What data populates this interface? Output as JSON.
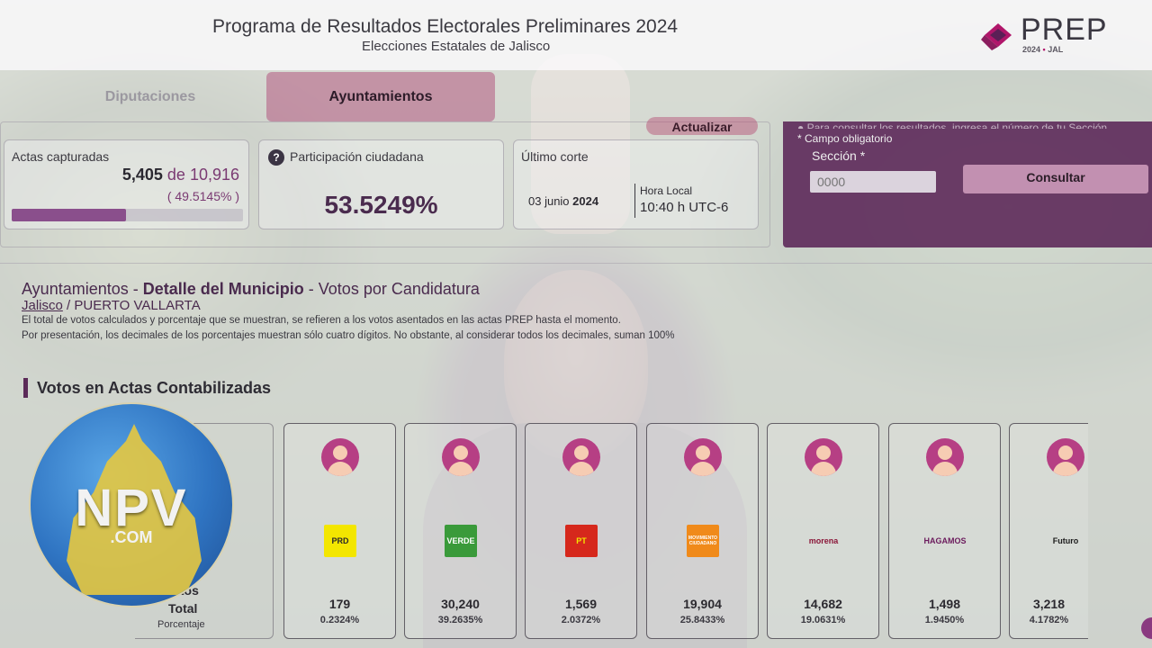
{
  "header": {
    "title": "Programa de Resultados Electorales Preliminares 2024",
    "subtitle": "Elecciones Estatales de Jalisco",
    "logo_text": "PREP",
    "logo_year": "2024",
    "logo_dot": "•",
    "logo_state": "JAL"
  },
  "tabs": [
    {
      "label": "Diputaciones"
    },
    {
      "label": "Ayuntamientos"
    }
  ],
  "refresh_label": "Actualizar",
  "stats": {
    "actas_label": "Actas capturadas",
    "actas_captured": "5,405",
    "actas_de": "de",
    "actas_total": "10,916",
    "actas_pct": "( 49.5145% )",
    "actas_progress": 0.495145,
    "participacion_icon": "?",
    "participacion_label": "Participación ciudadana",
    "participacion_value": "53.5249%",
    "corte_label": "Último corte",
    "corte_date_day": "03 junio",
    "corte_date_year": "2024",
    "hora_label": "Hora Local",
    "hora_value": "10:40 h UTC-6"
  },
  "search_panel": {
    "info": "● Para consultar los resultados, ingresa el número de tu Sección.",
    "required_note": "* Campo obligatorio",
    "seccion_label": "Sección *",
    "seccion_placeholder": "0000",
    "button_label": "Consultar"
  },
  "detail": {
    "title_a": "Ayuntamientos - ",
    "title_b": "Detalle del Municipio",
    "title_c": " - Votos por Candidatura",
    "crumb_link": "Jalisco",
    "crumb_rest": " / PUERTO VALLARTA",
    "note1": "El total de votos calculados y porcentaje que se muestran, se refieren a los votos asentados en las actas PREP hasta el momento.",
    "note2": "Por presentación, los decimales de los porcentajes muestran sólo cuatro dígitos. No obstante, al considerar todos los decimales, suman 100%"
  },
  "section_title": "Votos en Actas Contabilizadas",
  "row_labels": {
    "votos": "Votos",
    "total": "Total",
    "porcentaje": "Porcentaje"
  },
  "candidates": [
    {
      "party": "PRD",
      "votes": "179",
      "pct": "0.2324%",
      "bg": "#f3e600",
      "fg": "#2a2a2a"
    },
    {
      "party": "VERDE",
      "votes": "30,240",
      "pct": "39.2635%",
      "bg": "#3a9a3a",
      "fg": "#ffffff"
    },
    {
      "party": "PT",
      "votes": "1,569",
      "pct": "2.0372%",
      "bg": "#d6281c",
      "fg": "#f3e600"
    },
    {
      "party": "MOVIMIENTO CIUDADANO",
      "votes": "19,904",
      "pct": "25.8433%",
      "bg": "#f08a1a",
      "fg": "#ffffff"
    },
    {
      "party": "morena",
      "votes": "14,682",
      "pct": "19.0631%",
      "bg": "transparent",
      "fg": "#8a1538"
    },
    {
      "party": "HAGAMOS",
      "votes": "1,498",
      "pct": "1.9450%",
      "bg": "transparent",
      "fg": "#6b1a5c"
    },
    {
      "party": "Futuro",
      "votes": "3,218",
      "pct": "4.1782%",
      "bg": "transparent",
      "fg": "#1c1c1c"
    }
  ],
  "watermark": {
    "text": "NPV",
    "domain": ".COM"
  }
}
